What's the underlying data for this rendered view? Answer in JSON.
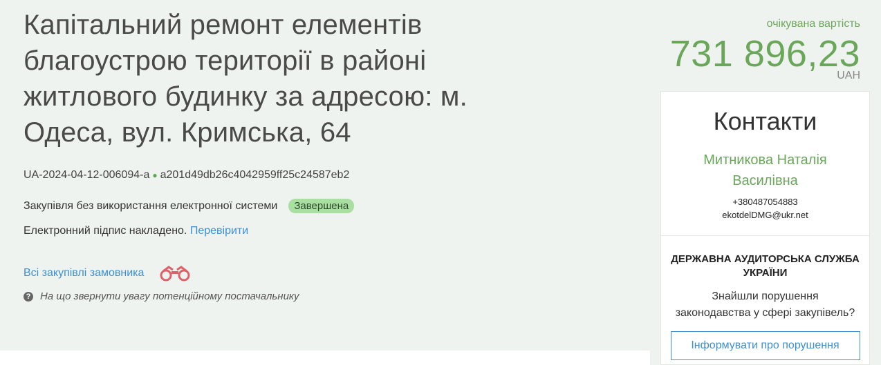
{
  "tender": {
    "title": "Капітальний ремонт елементів благоустрою території в районі житлового будинку за адресою: м. Одеса, вул. Кримська, 64",
    "tender_id": "UA-2024-04-12-006094-a",
    "hash": "a201d49db26c4042959ff25c24587eb2",
    "method": "Закупівля без використання електронної системи",
    "status": "Завершена",
    "signature_text": "Електронний підпис накладено.",
    "verify_link": "Перевірити",
    "all_procurements_link": "Всі закупівлі замовника",
    "hint": "На що звернути увагу потенційному постачальнику"
  },
  "cost": {
    "label": "очікувана вартість",
    "value": "731 896,23",
    "currency": "UAH"
  },
  "contacts": {
    "heading": "Контакти",
    "name": "Митникова Наталія Василівна",
    "phone": "+380487054883",
    "email": "ekotdelDMG@ukr.net"
  },
  "audit": {
    "title": "ДЕРЖАВНА АУДИТОРСЬКА СЛУЖБА УКРАЇНИ",
    "text": "Знайшли порушення законодавства у сфері закупівель?",
    "button": "Інформувати про порушення"
  },
  "colors": {
    "accent_green": "#6aa75a",
    "link_blue": "#3d8fd1",
    "badge_green": "#a9dfa1"
  }
}
